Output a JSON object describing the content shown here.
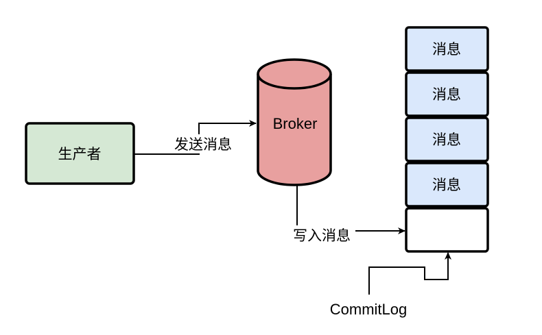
{
  "colors": {
    "producer_fill": "#d5e8d4",
    "broker_fill": "#e8a09f",
    "message_fill": "#dae8fc",
    "empty_slot_fill": "#ffffff",
    "stroke": "#000000"
  },
  "producer": {
    "label": "生产者"
  },
  "broker": {
    "label": "Broker"
  },
  "edges": {
    "send_label": "发送消息",
    "write_label": "写入消息"
  },
  "commitlog": {
    "label": "CommitLog",
    "messages": [
      "消息",
      "消息",
      "消息",
      "消息"
    ]
  }
}
